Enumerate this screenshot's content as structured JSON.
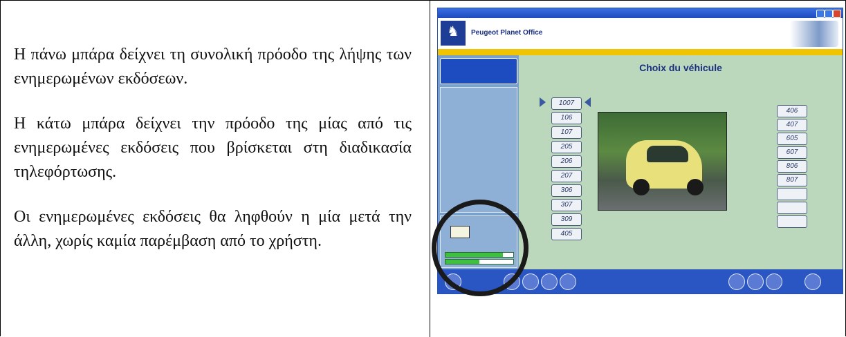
{
  "text_cell": {
    "para1": "Η πάνω μπάρα δείχνει τη συνολική πρόοδο της λήψης των ενημερωμένων εκδόσεων.",
    "para2": "Η κάτω μπάρα δείχνει την πρόοδο της μίας από τις ενημερωμένες εκδόσεις που βρίσκεται στη διαδικασία τηλεφόρτωσης.",
    "para3": "Οι ενημερωμένες εκδόσεις θα ληφθούν η μία μετά την άλλη, χωρίς καμία παρέμβαση από το χρήστη."
  },
  "screenshot": {
    "window_title": "",
    "brand": "Peugeot Planet Office",
    "sidebar_tab": "",
    "main_title": "Choix du véhicule",
    "left_models": [
      "1007",
      "106",
      "107",
      "205",
      "206",
      "207",
      "306",
      "307",
      "309",
      "405"
    ],
    "right_models": [
      "406",
      "407",
      "605",
      "607",
      "806",
      "807",
      "",
      "",
      ""
    ],
    "progress": {
      "overall_fraction": 0.85,
      "current_fraction": 0.5
    },
    "colors": {
      "accent_blue": "#2a56c4",
      "stripe_yellow": "#f0c400",
      "panel_green": "#bcd8bc"
    }
  }
}
